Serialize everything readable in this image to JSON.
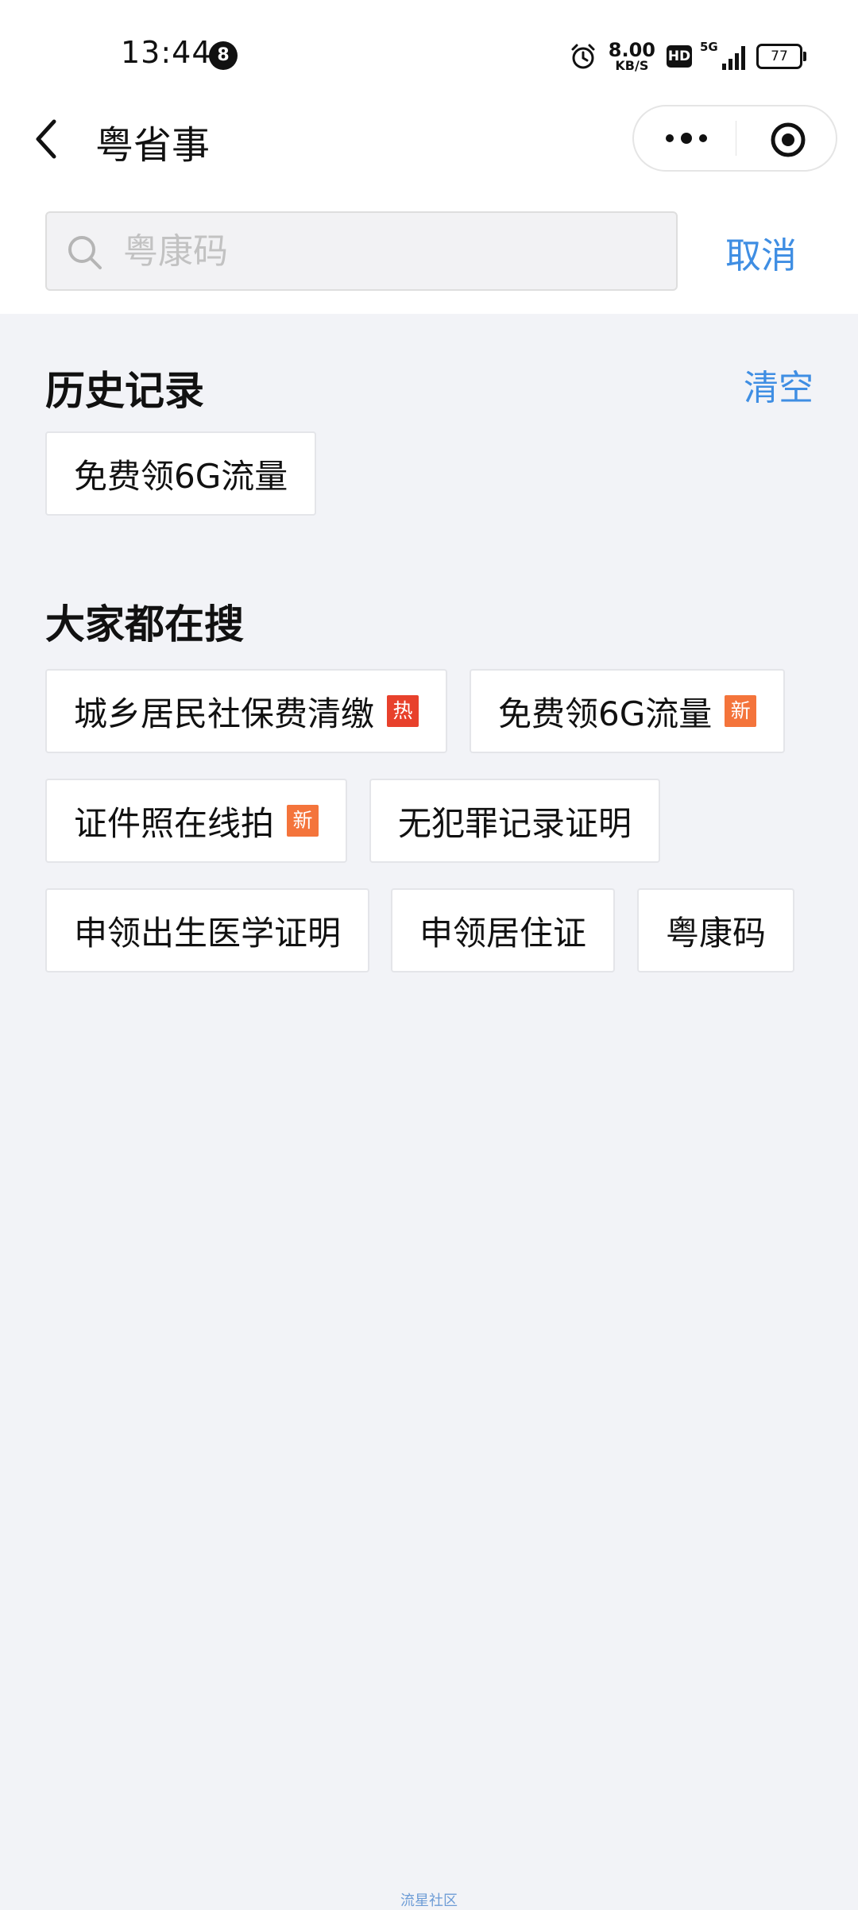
{
  "status_bar": {
    "time": "13:44",
    "notification_count": "8",
    "net_speed_value": "8.00",
    "net_speed_unit": "KB/S",
    "hd_label": "HD",
    "network_label": "5G",
    "battery": "77"
  },
  "nav": {
    "title": "粤省事"
  },
  "search": {
    "placeholder": "粤康码",
    "value": "",
    "cancel_label": "取消"
  },
  "history": {
    "title": "历史记录",
    "clear_label": "清空",
    "items": [
      "免费领6G流量"
    ]
  },
  "popular": {
    "title": "大家都在搜",
    "items": [
      {
        "label": "城乡居民社保费清缴",
        "badge": "热"
      },
      {
        "label": "免费领6G流量",
        "badge": "新"
      },
      {
        "label": "证件照在线拍",
        "badge": "新"
      },
      {
        "label": "无犯罪记录证明",
        "badge": ""
      },
      {
        "label": "申领出生医学证明",
        "badge": ""
      },
      {
        "label": "申领居住证",
        "badge": ""
      },
      {
        "label": "粤康码",
        "badge": ""
      }
    ]
  },
  "footer": {
    "text": "流星社区"
  },
  "colors": {
    "accent": "#3f8ee3",
    "hot_badge": "#e8412c",
    "new_badge": "#f4743b",
    "page_background": "#f2f3f7"
  }
}
